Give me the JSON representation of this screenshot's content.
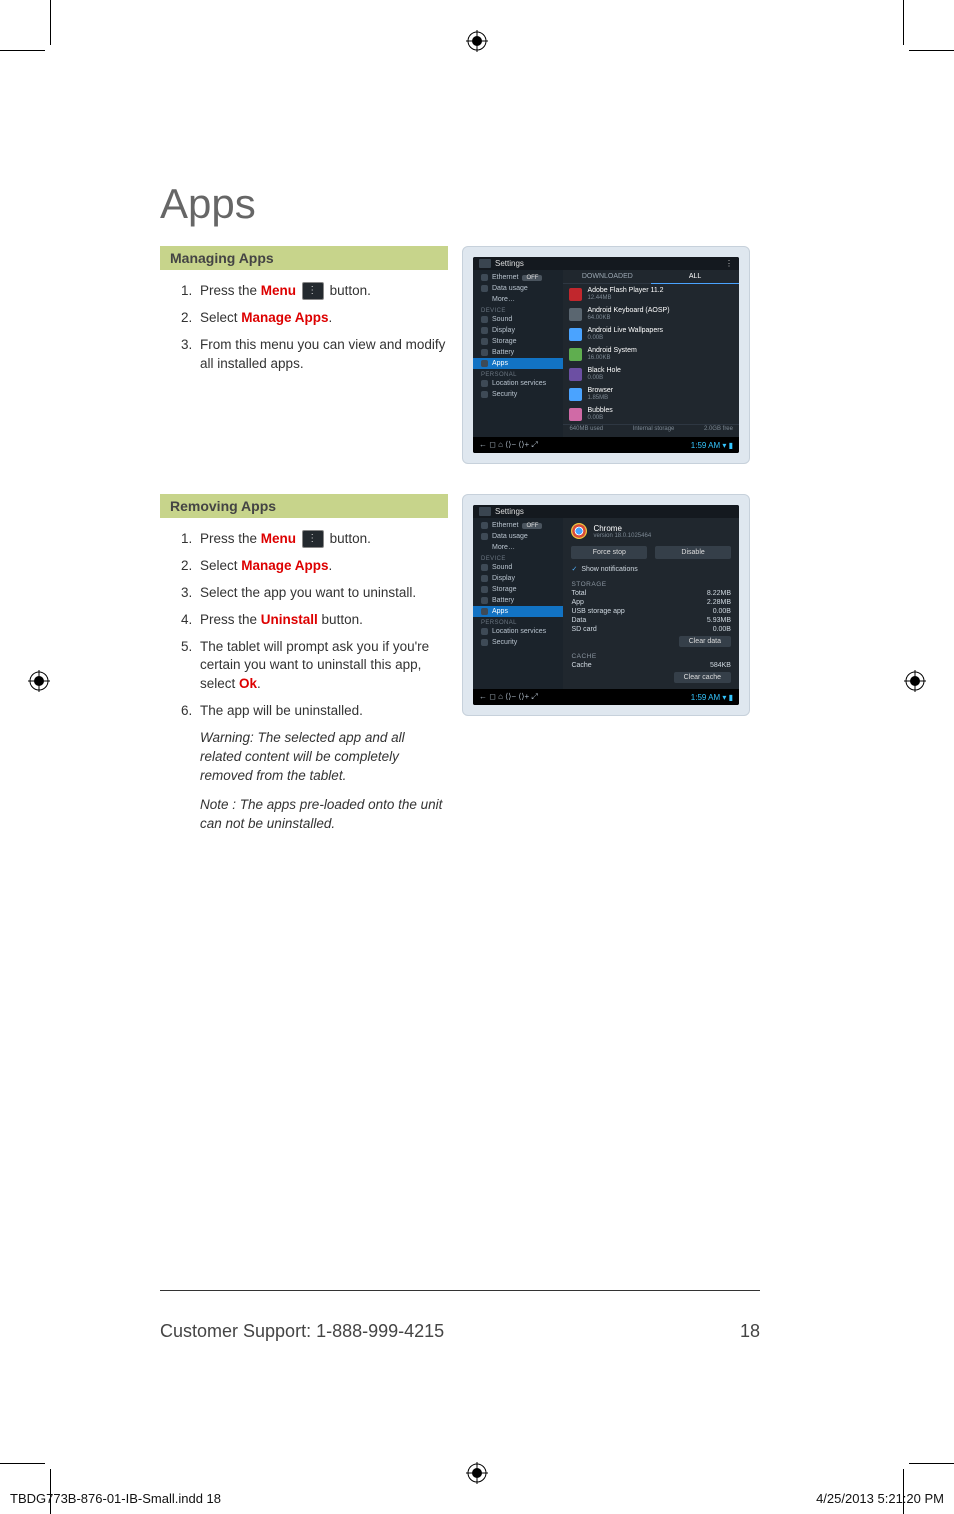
{
  "title": "Apps",
  "sections": {
    "managing": {
      "banner": "Managing Apps",
      "step1_a": "Press the ",
      "step1_menu": "Menu",
      "step1_b": " button.",
      "step2_a": "Select ",
      "step2_b": "Manage Apps",
      "step2_c": ".",
      "step3": "From this menu you can view and modify all installed apps."
    },
    "removing": {
      "banner": "Removing Apps",
      "step1_a": "Press the ",
      "step1_menu": "Menu",
      "step1_b": " button.",
      "step2_a": "Select ",
      "step2_b": "Manage Apps",
      "step2_c": ".",
      "step3": "Select the app you want to uninstall.",
      "step4_a": "Press the ",
      "step4_b": "Uninstall",
      "step4_c": " button.",
      "step5_a": "The tablet will prompt ask you if you're certain you want to uninstall this app, select ",
      "step5_b": "Ok",
      "step5_c": ".",
      "step6": "The app will be uninstalled.",
      "warn": "Warning: The selected app and all related content will be completely removed from the tablet.",
      "note": "Note : The apps pre-loaded onto the unit can not be uninstalled."
    }
  },
  "shot1": {
    "title": "Settings",
    "side": {
      "ethernet": "Ethernet",
      "off": "OFF",
      "data": "Data usage",
      "more": "More…",
      "cat_device": "DEVICE",
      "sound": "Sound",
      "display": "Display",
      "storage": "Storage",
      "battery": "Battery",
      "apps": "Apps",
      "cat_personal": "PERSONAL",
      "loc": "Location services",
      "sec": "Security"
    },
    "tabs": {
      "dl": "DOWNLOADED",
      "all": "ALL"
    },
    "apps": [
      {
        "name": "Adobe Flash Player 11.2",
        "size": "12.44MB",
        "color": "#c1272d"
      },
      {
        "name": "Android Keyboard (AOSP)",
        "size": "64.00KB",
        "color": "#5a6670"
      },
      {
        "name": "Android Live Wallpapers",
        "size": "0.00B",
        "color": "#4aa3ff"
      },
      {
        "name": "Android System",
        "size": "16.00KB",
        "color": "#5fae4f"
      },
      {
        "name": "Black Hole",
        "size": "0.00B",
        "color": "#6c4fa3"
      },
      {
        "name": "Browser",
        "size": "1.85MB",
        "color": "#4aa3ff"
      },
      {
        "name": "Bubbles",
        "size": "0.00B",
        "color": "#d06aa6"
      }
    ],
    "storagebar": {
      "left": "640MB used",
      "mid": "Internal storage",
      "right": "2.0GB free"
    },
    "time": "1:59 AM"
  },
  "shot2": {
    "title": "Settings",
    "side": {
      "ethernet": "Ethernet",
      "off": "OFF",
      "data": "Data usage",
      "more": "More…",
      "cat_device": "DEVICE",
      "sound": "Sound",
      "display": "Display",
      "storage": "Storage",
      "battery": "Battery",
      "apps": "Apps",
      "cat_personal": "PERSONAL",
      "loc": "Location services",
      "sec": "Security"
    },
    "info": {
      "name": "Chrome",
      "ver": "version 18.0.1025464",
      "btn_force": "Force stop",
      "btn_disable": "Disable",
      "shownotif": "Show notifications",
      "sec_storage": "STORAGE",
      "kv": [
        {
          "k": "Total",
          "v": "8.22MB"
        },
        {
          "k": "App",
          "v": "2.28MB"
        },
        {
          "k": "USB storage app",
          "v": "0.00B"
        },
        {
          "k": "Data",
          "v": "5.93MB"
        },
        {
          "k": "SD card",
          "v": "0.00B"
        }
      ],
      "btn_cleardata": "Clear data",
      "sec_cache": "CACHE",
      "cache_k": "Cache",
      "cache_v": "584KB",
      "btn_clearcache": "Clear cache"
    },
    "time": "1:59 AM"
  },
  "footer": {
    "left": "Customer Support: 1-888-999-4215",
    "right": "18"
  },
  "meta": {
    "left": "TBDG773B-876-01-IB-Small.indd   18",
    "right": "4/25/2013   5:21:20 PM"
  },
  "nav_icons": "←   ◻   ⌂   ⟨⟩−   ⟨⟩+   ⤢"
}
